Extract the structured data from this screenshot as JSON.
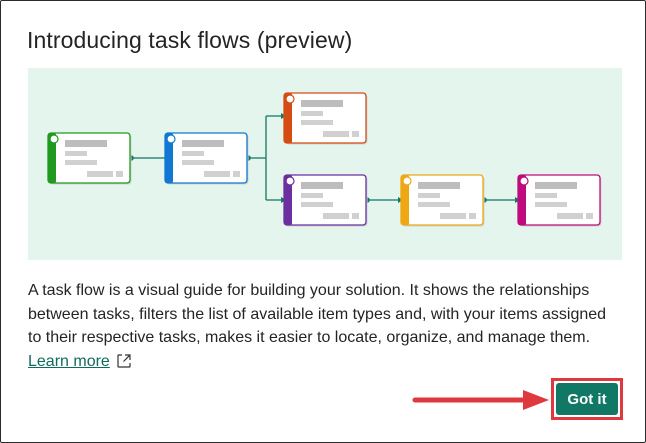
{
  "dialog": {
    "title": "Introducing task flows (preview)",
    "description": "A task flow is a visual guide for building your solution. It shows the relationships between tasks, filters the list of available item types and, with your items assigned to their respective tasks, makes it easier to locate, organize, and manage them.",
    "learn_more": "Learn more",
    "got_it_label": "Got it"
  },
  "illustration": {
    "task_colors": [
      "#1f9a1f",
      "#1177d3",
      "#d64a14",
      "#6b2fa0",
      "#efa712",
      "#bf0b7d"
    ],
    "connector_color": "#117865"
  },
  "colors": {
    "accent": "#117865",
    "highlight": "#e0383f",
    "link": "#0f6b5e",
    "illustration_bg": "#e3f5ec"
  },
  "icons": [
    "external-link-icon",
    "right-arrow-icon"
  ]
}
